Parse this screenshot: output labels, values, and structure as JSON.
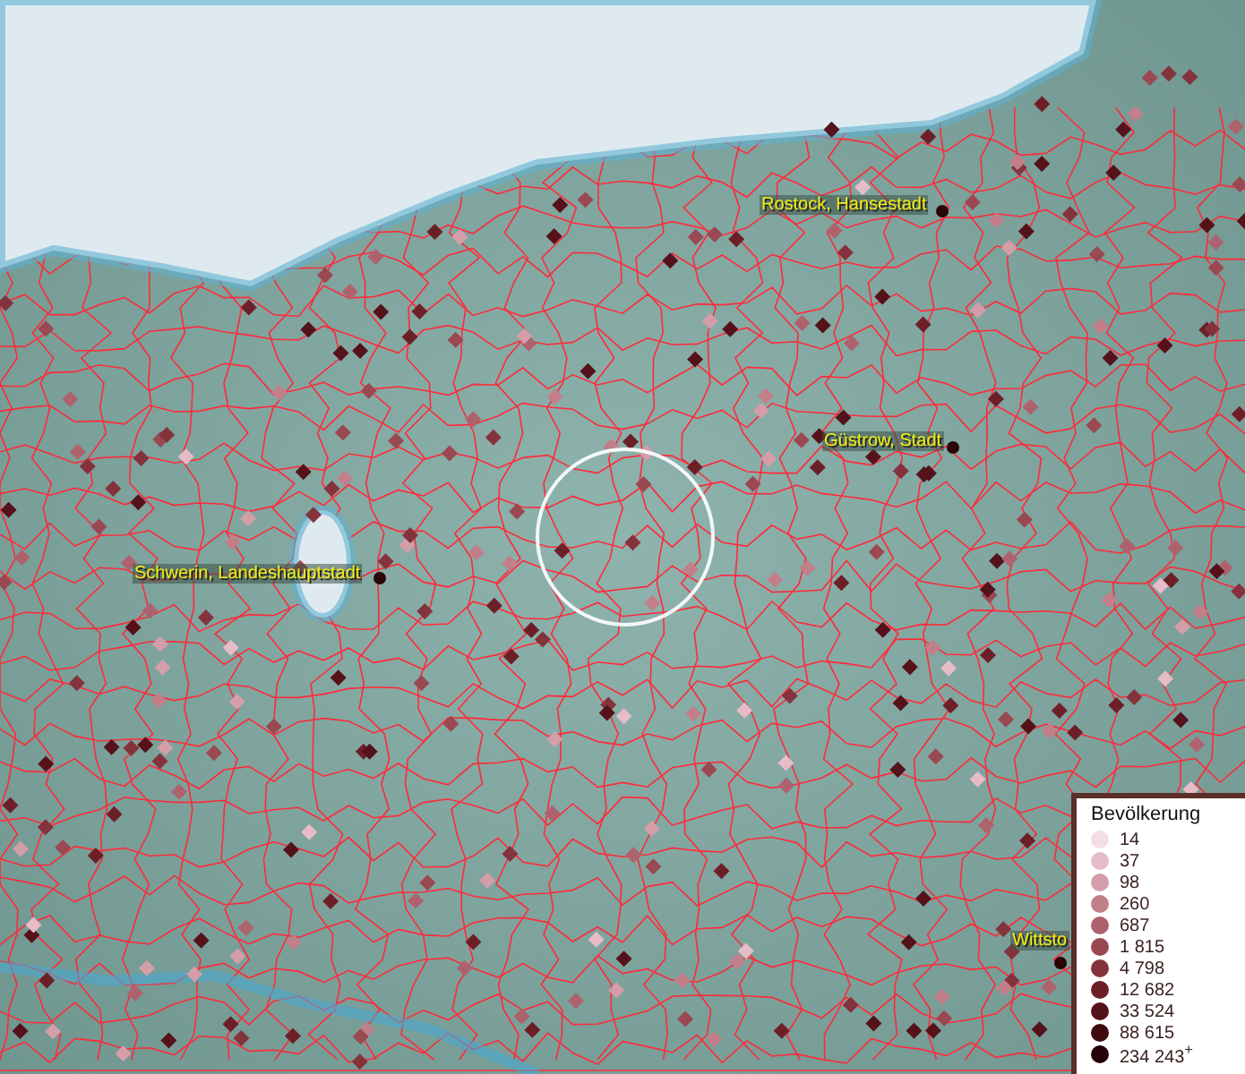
{
  "cities": [
    {
      "name": "Rostock, Hansestadt"
    },
    {
      "name": "Güstrow, Stadt"
    },
    {
      "name": "Schwerin, Landeshauptstadt"
    },
    {
      "name": "Wittsto"
    }
  ],
  "legend": {
    "title": "Bevölkerung",
    "items": [
      {
        "label": "14",
        "color": "#f5dde6"
      },
      {
        "label": "37",
        "color": "#e6bcc8"
      },
      {
        "label": "98",
        "color": "#d49ea9"
      },
      {
        "label": "260",
        "color": "#c27f8a"
      },
      {
        "label": "687",
        "color": "#ae626d"
      },
      {
        "label": "1 815",
        "color": "#9a4851"
      },
      {
        "label": "4 798",
        "color": "#84333c"
      },
      {
        "label": "12 682",
        "color": "#6d1f28"
      },
      {
        "label": "33 524",
        "color": "#55121a"
      },
      {
        "label": "88 615",
        "color": "#3e0a10"
      },
      {
        "label": "234 243$^{+}$",
        "color": "#240408"
      }
    ]
  }
}
